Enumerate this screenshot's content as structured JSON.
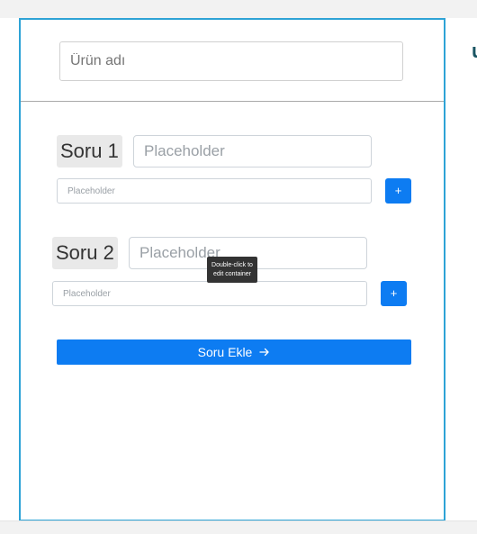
{
  "form": {
    "product_name_placeholder": "Ürün adı",
    "questions": [
      {
        "label": "Soru 1",
        "question_placeholder": "Placeholder",
        "answer_placeholder": "Placeholder",
        "add_label": "+"
      },
      {
        "label": "Soru 2",
        "question_placeholder": "Placeholder",
        "answer_placeholder": "Placeholder",
        "add_label": "+"
      }
    ],
    "add_question_label": "Soru Ekle"
  },
  "tooltip": {
    "line1": "Double-click to",
    "line2": "edit container"
  },
  "colors": {
    "accent": "#0d7cf2",
    "selection_border": "#2ea3d6",
    "tooltip_bg": "#333333"
  },
  "icons": {
    "add_question": "arrow-right-icon"
  }
}
